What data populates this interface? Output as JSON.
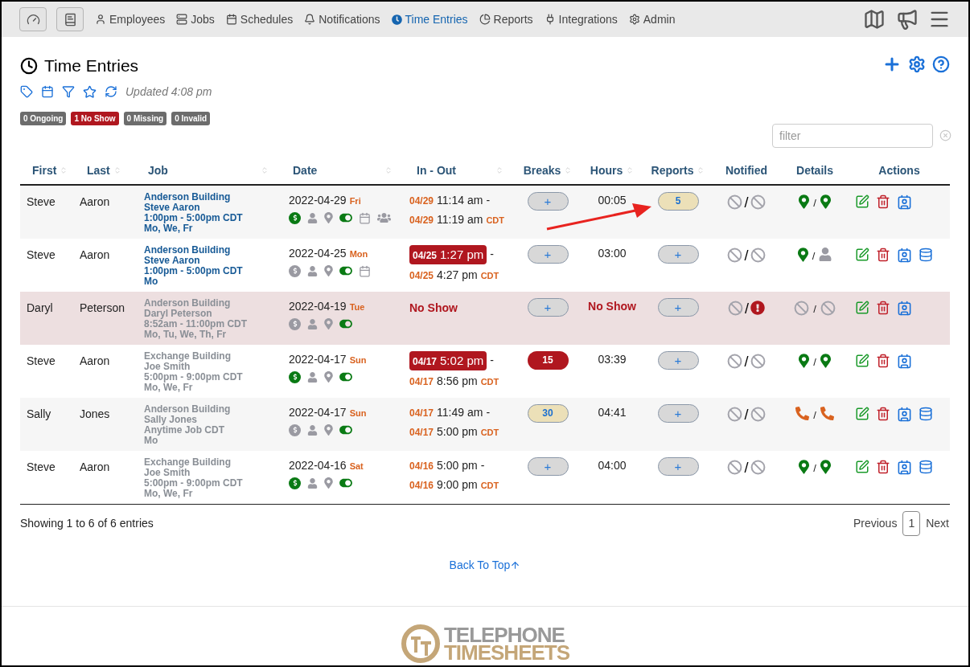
{
  "nav": {
    "buttons": [
      {
        "kind": "gauge"
      },
      {
        "kind": "book"
      }
    ],
    "items": [
      {
        "kind": "user",
        "label": "Employees",
        "selected": false
      },
      {
        "kind": "server",
        "label": "Jobs",
        "selected": false
      },
      {
        "kind": "calendar",
        "label": "Schedules",
        "selected": false
      },
      {
        "kind": "bell",
        "label": "Notifications",
        "selected": false
      },
      {
        "kind": "clock",
        "label": "Time Entries",
        "selected": true
      },
      {
        "kind": "chart",
        "label": "Reports",
        "selected": false
      },
      {
        "kind": "plug",
        "label": "Integrations",
        "selected": false
      },
      {
        "kind": "gear",
        "label": "Admin",
        "selected": false
      }
    ]
  },
  "page": {
    "title": "Time Entries",
    "updated": "Updated 4:08 pm",
    "badges": [
      {
        "label": "0 Ongoing",
        "color": "#6c6c6c"
      },
      {
        "label": "1 No Show",
        "color": "#b0171f"
      },
      {
        "label": "0 Missing",
        "color": "#6c6c6c"
      },
      {
        "label": "0 Invalid",
        "color": "#6c6c6c"
      }
    ],
    "filter": {
      "placeholder": "filter"
    }
  },
  "table": {
    "columns": [
      {
        "label": "First",
        "sortable": true
      },
      {
        "label": "Last",
        "sortable": true
      },
      {
        "label": "Job",
        "sortable": true
      },
      {
        "label": "Date",
        "sortable": true
      },
      {
        "label": "In - Out",
        "sortable": true
      },
      {
        "label": "Breaks",
        "sortable": true
      },
      {
        "label": "Hours",
        "sortable": true
      },
      {
        "label": "Reports",
        "sortable": true
      },
      {
        "label": "Notified",
        "sortable": false
      },
      {
        "label": "Details",
        "sortable": false
      },
      {
        "label": "Actions",
        "sortable": false
      }
    ],
    "rows": [
      {
        "first": "Steve",
        "last": "Aaron",
        "no_show": false,
        "job": {
          "active": true,
          "lines": [
            "Anderson Building",
            "Steve Aaron",
            "1:00pm - 5:00pm CDT",
            "Mo, We, Fr"
          ]
        },
        "date": "2022-04-29",
        "weekday": "Fri",
        "icons": [
          {
            "kind": "dollar",
            "active": true
          },
          {
            "kind": "person",
            "active": false
          },
          {
            "kind": "pin",
            "active": false
          },
          {
            "kind": "toggle",
            "active": true
          },
          {
            "kind": "calendar",
            "active": false
          },
          {
            "kind": "group",
            "active": false
          }
        ],
        "in_out": {
          "kind": "times",
          "in_date": "04/29",
          "in_time": "11:14 am",
          "in_late": false,
          "separator": "-",
          "out_date": "04/29",
          "out_time": "11:19 am",
          "tz": "CDT"
        },
        "breaks": {
          "kind": "add",
          "text": "+"
        },
        "hours": {
          "text": "00:05",
          "alert": false
        },
        "reports": {
          "kind": "count",
          "text": "5",
          "color": "#ece0b8"
        },
        "notified": {
          "separator": "/",
          "items": [
            {
              "kind": "none"
            },
            {
              "kind": "none"
            }
          ]
        },
        "details": {
          "separator": "/",
          "items": [
            {
              "kind": "pin"
            },
            {
              "kind": "pin"
            }
          ]
        },
        "actions": [
          {
            "kind": "edit"
          },
          {
            "kind": "delete"
          },
          {
            "kind": "contact"
          }
        ]
      },
      {
        "first": "Steve",
        "last": "Aaron",
        "no_show": false,
        "job": {
          "active": true,
          "lines": [
            "Anderson Building",
            "Steve Aaron",
            "1:00pm - 5:00pm CDT",
            "Mo"
          ]
        },
        "date": "2022-04-25",
        "weekday": "Mon",
        "icons": [
          {
            "kind": "dollar",
            "active": false
          },
          {
            "kind": "person",
            "active": false
          },
          {
            "kind": "pin",
            "active": false
          },
          {
            "kind": "toggle",
            "active": true
          },
          {
            "kind": "calendar",
            "active": false
          }
        ],
        "in_out": {
          "kind": "times",
          "in_date": "04/25",
          "in_time": "1:27 pm",
          "in_late": true,
          "separator": "-",
          "out_date": "04/25",
          "out_time": "4:27 pm",
          "tz": "CDT"
        },
        "breaks": {
          "kind": "add",
          "text": "+"
        },
        "hours": {
          "text": "03:00",
          "alert": false
        },
        "reports": {
          "kind": "add",
          "text": "+"
        },
        "notified": {
          "separator": "/",
          "items": [
            {
              "kind": "none"
            },
            {
              "kind": "none"
            }
          ]
        },
        "details": {
          "separator": "/",
          "items": [
            {
              "kind": "pin"
            },
            {
              "kind": "person"
            }
          ]
        },
        "actions": [
          {
            "kind": "edit"
          },
          {
            "kind": "delete"
          },
          {
            "kind": "contact"
          },
          {
            "kind": "database"
          }
        ]
      },
      {
        "first": "Daryl",
        "last": "Peterson",
        "no_show": true,
        "job": {
          "active": false,
          "lines": [
            "Anderson Building",
            "Daryl Peterson",
            "8:52am - 11:00pm CDT",
            "Mo, Tu, We, Th, Fr"
          ]
        },
        "date": "2022-04-19",
        "weekday": "Tue",
        "icons": [
          {
            "kind": "dollar",
            "active": false
          },
          {
            "kind": "person",
            "active": false
          },
          {
            "kind": "pin",
            "active": false
          },
          {
            "kind": "toggle",
            "active": true
          }
        ],
        "in_out": {
          "kind": "noshow",
          "text": "No Show"
        },
        "breaks": {
          "kind": "add",
          "text": "+"
        },
        "hours": {
          "text": "No Show",
          "alert": true
        },
        "reports": {
          "kind": "add",
          "text": "+"
        },
        "notified": {
          "separator": "/",
          "items": [
            {
              "kind": "none"
            },
            {
              "kind": "alert"
            }
          ]
        },
        "details": {
          "separator": "/",
          "items": [
            {
              "kind": "none"
            },
            {
              "kind": "none"
            }
          ]
        },
        "actions": [
          {
            "kind": "edit"
          },
          {
            "kind": "delete"
          },
          {
            "kind": "contact"
          }
        ]
      },
      {
        "first": "Steve",
        "last": "Aaron",
        "no_show": false,
        "job": {
          "active": false,
          "lines": [
            "Exchange Building",
            "Joe Smith",
            "5:00pm - 9:00pm CDT",
            "Mo, We, Fr"
          ]
        },
        "date": "2022-04-17",
        "weekday": "Sun",
        "icons": [
          {
            "kind": "dollar",
            "active": true
          },
          {
            "kind": "person",
            "active": false
          },
          {
            "kind": "pin",
            "active": false
          },
          {
            "kind": "toggle",
            "active": true
          }
        ],
        "in_out": {
          "kind": "times",
          "in_date": "04/17",
          "in_time": "5:02 pm",
          "in_late": true,
          "separator": "-",
          "out_date": "04/17",
          "out_time": "8:56 pm",
          "tz": "CDT"
        },
        "breaks": {
          "kind": "count",
          "text": "15",
          "color": "#b0171f"
        },
        "hours": {
          "text": "03:39",
          "alert": false
        },
        "reports": {
          "kind": "add",
          "text": "+"
        },
        "notified": {
          "separator": "/",
          "items": [
            {
              "kind": "none"
            },
            {
              "kind": "none"
            }
          ]
        },
        "details": {
          "separator": "/",
          "items": [
            {
              "kind": "pin"
            },
            {
              "kind": "pin"
            }
          ]
        },
        "actions": [
          {
            "kind": "edit"
          },
          {
            "kind": "delete"
          },
          {
            "kind": "contact"
          }
        ]
      },
      {
        "first": "Sally",
        "last": "Jones",
        "no_show": false,
        "job": {
          "active": false,
          "lines": [
            "Anderson Building",
            "Sally Jones",
            "Anytime Job CDT",
            "Mo"
          ]
        },
        "date": "2022-04-17",
        "weekday": "Sun",
        "icons": [
          {
            "kind": "dollar",
            "active": false
          },
          {
            "kind": "person",
            "active": false
          },
          {
            "kind": "pin",
            "active": false
          },
          {
            "kind": "toggle",
            "active": true
          }
        ],
        "in_out": {
          "kind": "times",
          "in_date": "04/17",
          "in_time": "11:49 am",
          "in_late": false,
          "separator": "-",
          "out_date": "04/17",
          "out_time": "5:00 pm",
          "tz": "CDT"
        },
        "breaks": {
          "kind": "count",
          "text": "30",
          "color": "#ece0b8"
        },
        "hours": {
          "text": "04:41",
          "alert": false
        },
        "reports": {
          "kind": "add",
          "text": "+"
        },
        "notified": {
          "separator": "/",
          "items": [
            {
              "kind": "none"
            },
            {
              "kind": "none"
            }
          ]
        },
        "details": {
          "separator": "/",
          "items": [
            {
              "kind": "phone"
            },
            {
              "kind": "phone"
            }
          ]
        },
        "actions": [
          {
            "kind": "edit"
          },
          {
            "kind": "delete"
          },
          {
            "kind": "contact"
          },
          {
            "kind": "database"
          }
        ]
      },
      {
        "first": "Steve",
        "last": "Aaron",
        "no_show": false,
        "job": {
          "active": false,
          "lines": [
            "Exchange Building",
            "Joe Smith",
            "5:00pm - 9:00pm CDT",
            "Mo, We, Fr"
          ]
        },
        "date": "2022-04-16",
        "weekday": "Sat",
        "icons": [
          {
            "kind": "dollar",
            "active": true
          },
          {
            "kind": "person",
            "active": false
          },
          {
            "kind": "pin",
            "active": false
          },
          {
            "kind": "toggle",
            "active": true
          }
        ],
        "in_out": {
          "kind": "times",
          "in_date": "04/16",
          "in_time": "5:00 pm",
          "in_late": false,
          "separator": "-",
          "out_date": "04/16",
          "out_time": "9:00 pm",
          "tz": "CDT"
        },
        "breaks": {
          "kind": "add",
          "text": "+"
        },
        "hours": {
          "text": "04:00",
          "alert": false
        },
        "reports": {
          "kind": "add",
          "text": "+"
        },
        "notified": {
          "separator": "/",
          "items": [
            {
              "kind": "none"
            },
            {
              "kind": "none"
            }
          ]
        },
        "details": {
          "separator": "/",
          "items": [
            {
              "kind": "pin"
            },
            {
              "kind": "pin"
            }
          ]
        },
        "actions": [
          {
            "kind": "edit"
          },
          {
            "kind": "delete"
          },
          {
            "kind": "contact"
          },
          {
            "kind": "database"
          }
        ]
      }
    ]
  },
  "footer": {
    "summary": "Showing 1 to 6 of 6 entries",
    "pagination": [
      {
        "label": "Previous",
        "selected": false
      },
      {
        "label": "1",
        "selected": true
      },
      {
        "label": "Next",
        "selected": false
      }
    ],
    "back_to_top": "Back To Top",
    "logo": {
      "line1": "TELEPHONE",
      "line2": "TIMESHEETS"
    }
  }
}
